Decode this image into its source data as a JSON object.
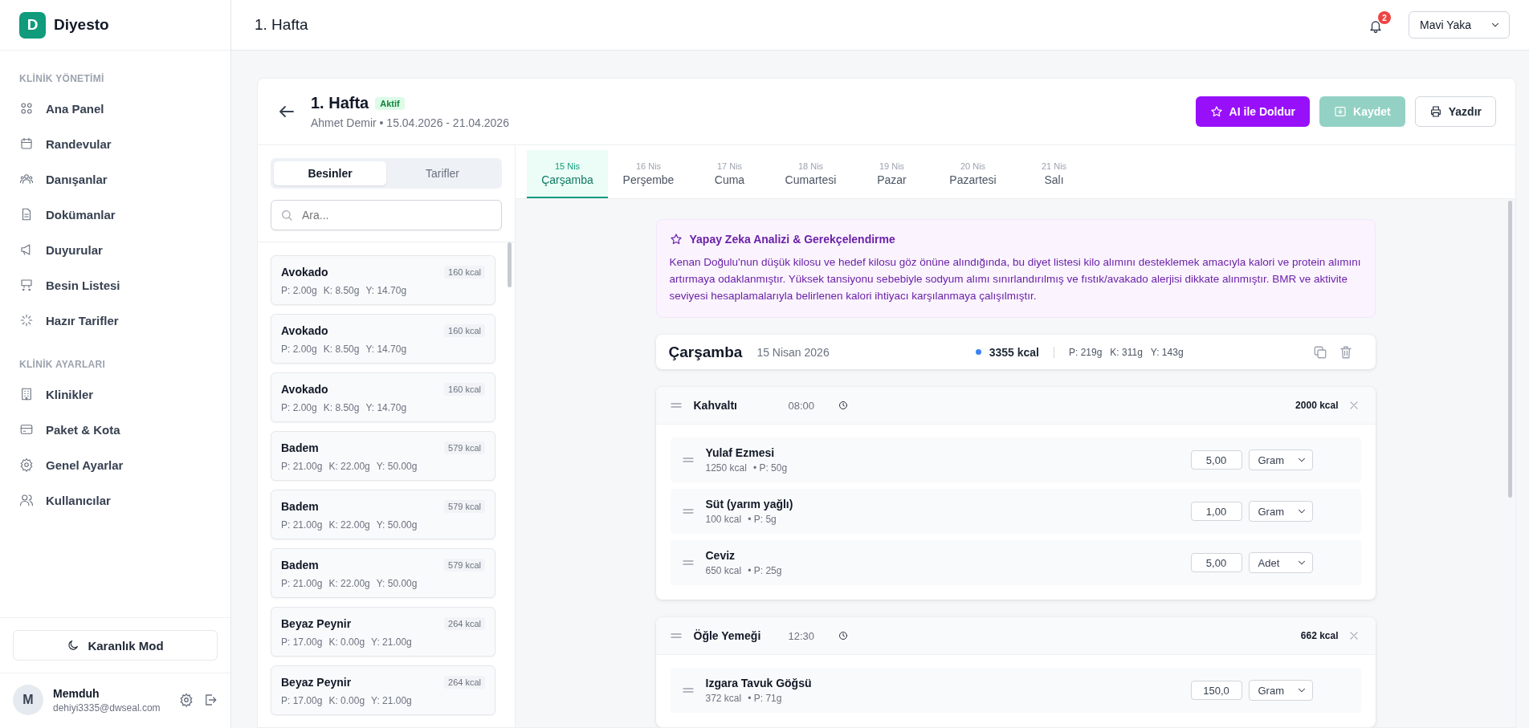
{
  "app": {
    "logo_letter": "D",
    "name": "Diyesto"
  },
  "sidebar": {
    "sections": [
      {
        "title": "KLİNİK YÖNETİMİ",
        "items": [
          {
            "label": "Ana Panel",
            "kind": "grid"
          },
          {
            "label": "Randevular",
            "kind": "calendar"
          },
          {
            "label": "Danışanlar",
            "kind": "group"
          },
          {
            "label": "Dokümanlar",
            "kind": "file"
          },
          {
            "label": "Duyurular",
            "kind": "megaphone"
          },
          {
            "label": "Besin Listesi",
            "kind": "cart"
          },
          {
            "label": "Hazır Tarifler",
            "kind": "loader"
          }
        ]
      },
      {
        "title": "KLİNİK AYARLARI",
        "items": [
          {
            "label": "Klinikler",
            "kind": "building"
          },
          {
            "label": "Paket & Kota",
            "kind": "card"
          },
          {
            "label": "Genel Ayarlar",
            "kind": "gear"
          },
          {
            "label": "Kullanıcılar",
            "kind": "users"
          }
        ]
      }
    ],
    "dark_mode_button": "Karanlık Mod",
    "user": {
      "initial": "M",
      "name": "Memduh",
      "email": "dehiyi3335@dwseal.com"
    }
  },
  "header": {
    "title": "1. Hafta",
    "notification_count": "2",
    "role_select": "Mavi Yaka"
  },
  "plan": {
    "title": "1. Hafta",
    "status": "Aktif",
    "subtitle": "Ahmet Demir • 15.04.2026 - 21.04.2026",
    "buttons": [
      {
        "label": "AI ile Doldur",
        "kind": "ai",
        "disabled": false
      },
      {
        "label": "Kaydet",
        "kind": "save",
        "disabled": true
      },
      {
        "label": "Yazdır",
        "kind": "print",
        "disabled": false
      }
    ]
  },
  "library": {
    "tabs": [
      {
        "label": "Besinler",
        "selected": true
      },
      {
        "label": "Tarifler",
        "selected": false
      }
    ],
    "search": {
      "placeholder": "Ara..."
    },
    "foods": [
      {
        "name": "Avokado",
        "kcal": "160 kcal",
        "protein": "P: 2.00g",
        "carbs": "K: 8.50g",
        "fat": "Y: 14.70g"
      },
      {
        "name": "Avokado",
        "kcal": "160 kcal",
        "protein": "P: 2.00g",
        "carbs": "K: 8.50g",
        "fat": "Y: 14.70g"
      },
      {
        "name": "Avokado",
        "kcal": "160 kcal",
        "protein": "P: 2.00g",
        "carbs": "K: 8.50g",
        "fat": "Y: 14.70g"
      },
      {
        "name": "Badem",
        "kcal": "579 kcal",
        "protein": "P: 21.00g",
        "carbs": "K: 22.00g",
        "fat": "Y: 50.00g"
      },
      {
        "name": "Badem",
        "kcal": "579 kcal",
        "protein": "P: 21.00g",
        "carbs": "K: 22.00g",
        "fat": "Y: 50.00g"
      },
      {
        "name": "Badem",
        "kcal": "579 kcal",
        "protein": "P: 21.00g",
        "carbs": "K: 22.00g",
        "fat": "Y: 50.00g"
      },
      {
        "name": "Beyaz Peynir",
        "kcal": "264 kcal",
        "protein": "P: 17.00g",
        "carbs": "K: 0.00g",
        "fat": "Y: 21.00g"
      },
      {
        "name": "Beyaz Peynir",
        "kcal": "264 kcal",
        "protein": "P: 17.00g",
        "carbs": "K: 0.00g",
        "fat": "Y: 21.00g"
      }
    ]
  },
  "days": [
    {
      "date": "15 Nis",
      "label": "Çarşamba",
      "selected": true
    },
    {
      "date": "16 Nis",
      "label": "Perşembe",
      "selected": false
    },
    {
      "date": "17 Nis",
      "label": "Cuma",
      "selected": false
    },
    {
      "date": "18 Nis",
      "label": "Cumartesi",
      "selected": false
    },
    {
      "date": "19 Nis",
      "label": "Pazar",
      "selected": false
    },
    {
      "date": "20 Nis",
      "label": "Pazartesi",
      "selected": false
    },
    {
      "date": "21 Nis",
      "label": "Salı",
      "selected": false
    }
  ],
  "ai_analysis": {
    "title": "Yapay Zeka Analizi & Gerekçelendirme",
    "text": "Kenan Doğulu'nun düşük kilosu ve hedef kilosu göz önüne alındığında, bu diyet listesi kilo alımını desteklemek amacıyla kalori ve protein alımını artırmaya odaklanmıştır. Yüksek tansiyonu sebebiyle sodyum alımı sınırlandırılmış ve fıstık/avakado alerjisi dikkate alınmıştır. BMR ve aktivite seviyesi hesaplamalarıyla belirlenen kalori ihtiyacı karşılanmaya çalışılmıştır."
  },
  "day_summary": {
    "day": "Çarşamba",
    "date": "15 Nisan 2026",
    "kcal": "3355 kcal",
    "protein": "P: 219g",
    "carbs": "K: 311g",
    "fat": "Y: 143g"
  },
  "meals": [
    {
      "name": "Kahvaltı",
      "time": "08:00",
      "kcal": "2000 kcal",
      "items": [
        {
          "name": "Yulaf Ezmesi",
          "kcal": "1250 kcal",
          "protein": "• P: 50g",
          "amount": "5,00",
          "unit": "Gram"
        },
        {
          "name": "Süt (yarım yağlı)",
          "kcal": "100 kcal",
          "protein": "• P: 5g",
          "amount": "1,00",
          "unit": "Gram"
        },
        {
          "name": "Ceviz",
          "kcal": "650 kcal",
          "protein": "• P: 25g",
          "amount": "5,00",
          "unit": "Adet"
        }
      ]
    },
    {
      "name": "Öğle Yemeği",
      "time": "12:30",
      "kcal": "662 kcal",
      "items": [
        {
          "name": "Izgara Tavuk Göğsü",
          "kcal": "372 kcal",
          "protein": "• P: 71g",
          "amount": "150,0",
          "unit": "Gram"
        }
      ]
    }
  ]
}
